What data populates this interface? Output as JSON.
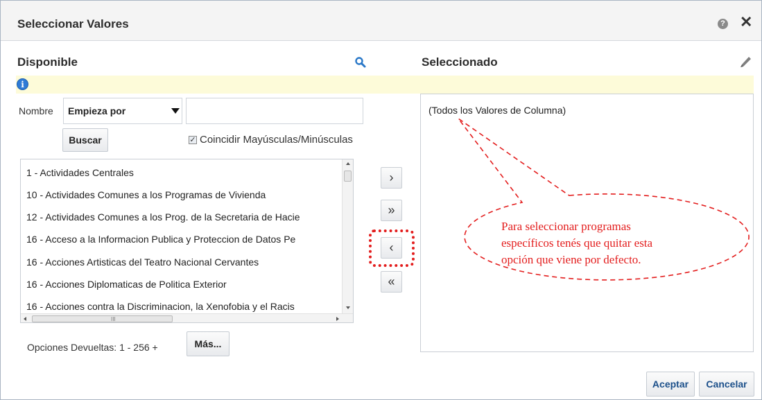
{
  "dialog": {
    "title": "Seleccionar Valores",
    "help_icon": "help-icon",
    "close_icon": "close-icon",
    "close_glyph": "✕"
  },
  "available": {
    "heading": "Disponible",
    "search_icon": "search-icon",
    "name_label": "Nombre",
    "match_select_value": "Empieza por",
    "search_input_value": "",
    "search_button": "Buscar",
    "case_checkbox_label": "Coincidir Mayúsculas/Minúsculas",
    "case_checkbox_checked": true,
    "items": [
      "1 - Actividades Centrales",
      "10 - Actividades Comunes a los Programas de Vivienda",
      "12 - Actividades Comunes a los Prog. de la Secretaria de Hacie",
      "16 - Acceso a la Informacion Publica y Proteccion de Datos Pe",
      "16 - Acciones Artisticas del Teatro Nacional Cervantes",
      "16 - Acciones Diplomaticas de Politica Exterior",
      "16 - Acciones contra la Discriminacion, la Xenofobia y el Racis"
    ],
    "returned_label": "Opciones Devueltas: 1 - 256 +",
    "more_button": "Más..."
  },
  "shuttle": {
    "move": "›",
    "move_all": "»",
    "remove": "‹",
    "remove_all": "«"
  },
  "selected": {
    "heading": "Seleccionado",
    "edit_icon": "pencil-icon",
    "items": [
      "(Todos los Valores de Columna)"
    ]
  },
  "annotation": {
    "lines": [
      "Para seleccionar programas",
      "específicos tenés que quitar esta",
      "opción que viene por defecto."
    ],
    "color": "#e31d1d"
  },
  "footer": {
    "accept_button": "Aceptar",
    "cancel_button": "Cancelar"
  },
  "info_icon": "info-icon"
}
